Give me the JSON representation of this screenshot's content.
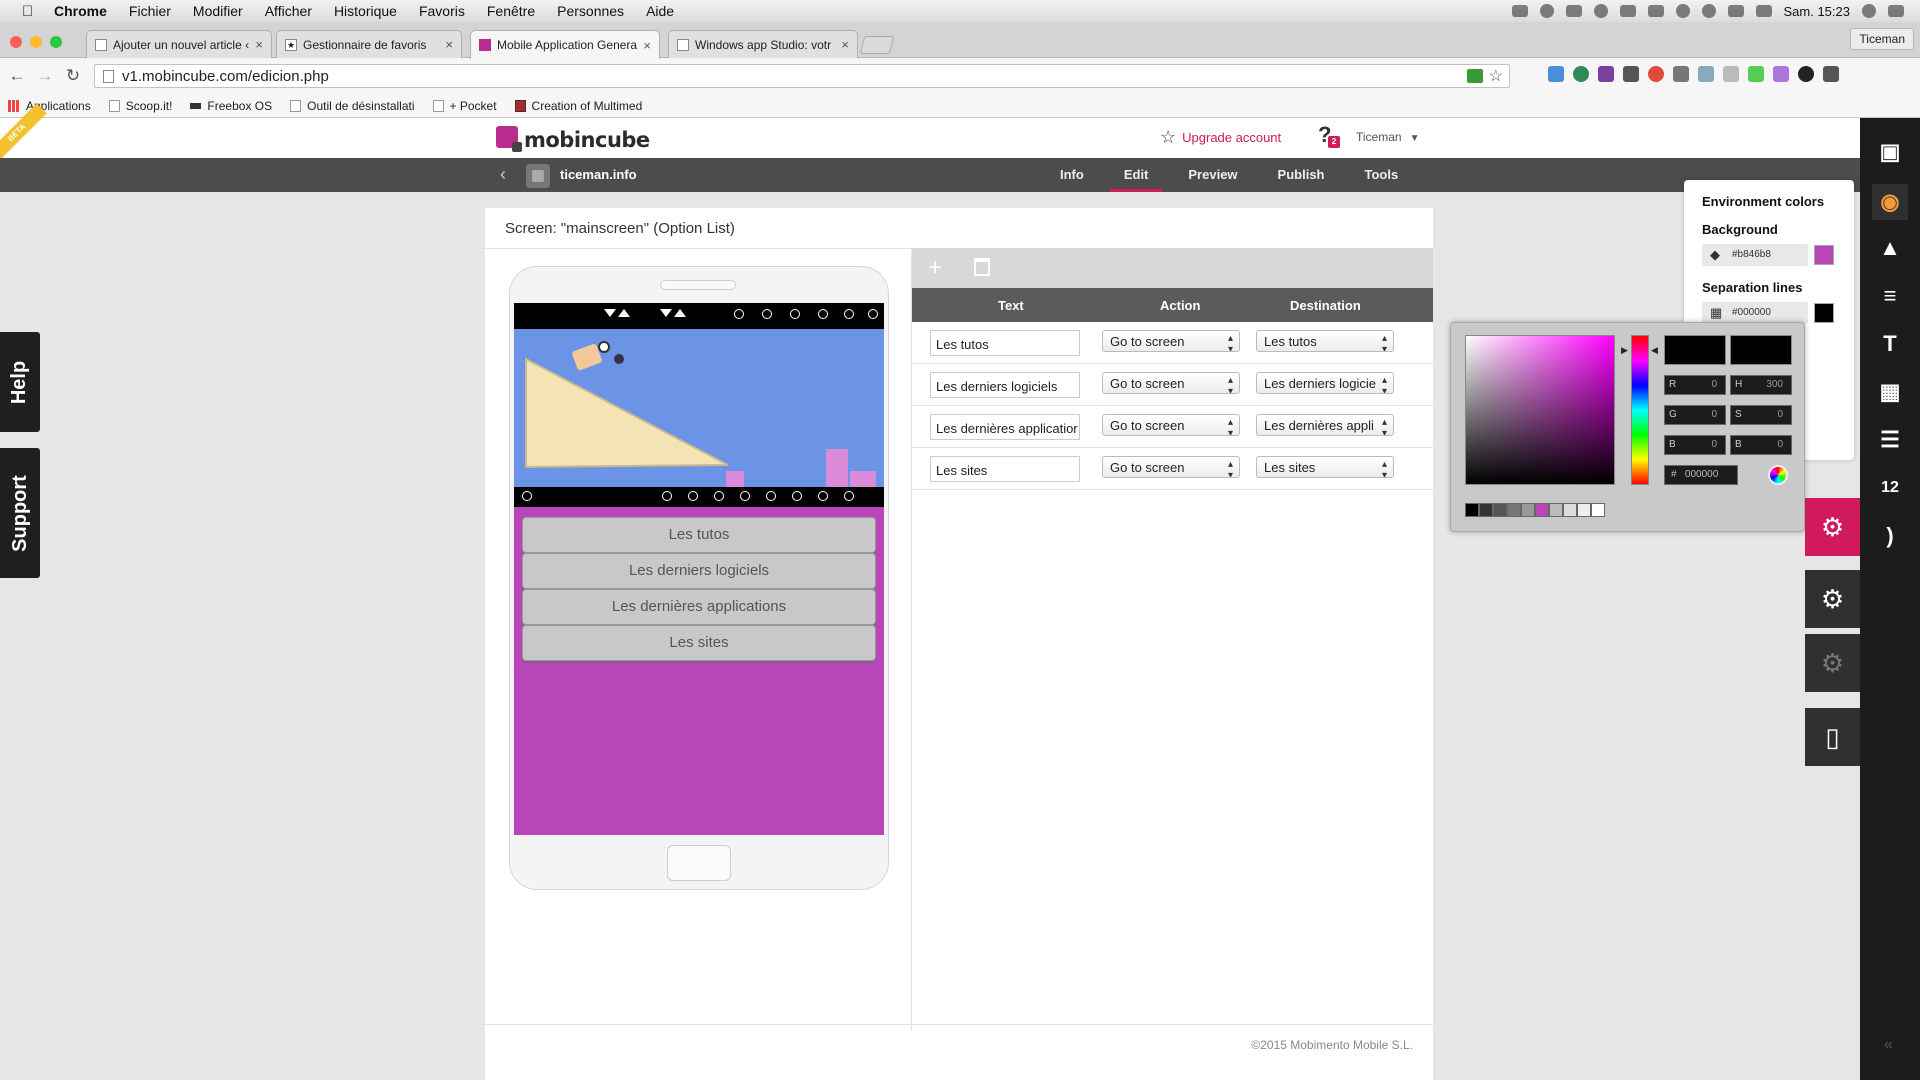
{
  "menubar": {
    "app": "Chrome",
    "items": [
      "Fichier",
      "Modifier",
      "Afficher",
      "Historique",
      "Favoris",
      "Fenêtre",
      "Personnes",
      "Aide"
    ],
    "clock": "Sam. 15:23"
  },
  "browser": {
    "tabs": [
      {
        "title": "Ajouter un nouvel article ‹ I",
        "close": "×"
      },
      {
        "title": "Gestionnaire de favoris",
        "close": "×"
      },
      {
        "title": "Mobile Application Genera",
        "close": "×"
      },
      {
        "title": "Windows app Studio: votr",
        "close": "×"
      }
    ],
    "profile": "Ticeman",
    "url": "v1.mobincube.com/edicion.php",
    "bookmarks": [
      "Applications",
      "Scoop.it!",
      "Freebox OS",
      "Outil de désinstallati",
      "+ Pocket",
      "Creation of Multimed"
    ]
  },
  "mobincube": {
    "beta": "BETA",
    "logo": "mobincube",
    "upgrade": "Upgrade account",
    "help_badge": "2",
    "user": "Ticeman",
    "app_name": "ticeman.info",
    "nav": [
      "Info",
      "Edit",
      "Preview",
      "Publish",
      "Tools"
    ],
    "active_nav": "Edit",
    "side_tabs": {
      "help": "Help",
      "support": "Support"
    },
    "screen_title": "Screen: \"mainscreen\" (Option List)",
    "copyright": "©2015 Mobimento Mobile S.L."
  },
  "phone": {
    "options": [
      "Les tutos",
      "Les derniers logiciels",
      "Les dernières applications",
      "Les sites"
    ],
    "background": "#b846b8"
  },
  "table": {
    "headers": {
      "text": "Text",
      "action": "Action",
      "destination": "Destination"
    },
    "rows": [
      {
        "text": "Les tutos",
        "action": "Go to screen",
        "destination": "Les tutos"
      },
      {
        "text": "Les derniers logiciels",
        "action": "Go to screen",
        "destination": "Les derniers logicie"
      },
      {
        "text": "Les dernières applicatior",
        "action": "Go to screen",
        "destination": "Les dernières appli"
      },
      {
        "text": "Les sites",
        "action": "Go to screen",
        "destination": "Les sites"
      }
    ]
  },
  "env_colors": {
    "title": "Environment colors",
    "background_label": "Background",
    "background_value": "#b846b8",
    "separation_label": "Separation lines",
    "separation_value": "#000000"
  },
  "picker": {
    "r_label": "R",
    "r": "0",
    "g_label": "G",
    "g": "0",
    "b_label": "B",
    "b": "0",
    "h_label": "H",
    "h": "300",
    "s_label": "S",
    "s": "0",
    "br_label": "B",
    "br": "0",
    "hex_label": "#",
    "hex": "000000",
    "swatches": [
      "#000000",
      "#333333",
      "#555555",
      "#777777",
      "#999999",
      "#b846b8",
      "#bbbbbb",
      "#dddddd",
      "#eeeeee",
      "#ffffff"
    ]
  },
  "colors": {
    "accent": "#d11a5c",
    "nav_bg": "#4c4c4c",
    "right_bar": "#1c1c1c"
  }
}
